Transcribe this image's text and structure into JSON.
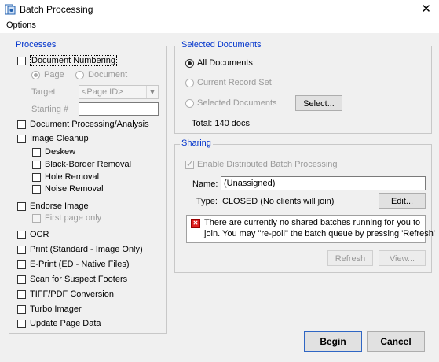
{
  "window": {
    "title": "Batch Processing",
    "close_glyph": "✕"
  },
  "menu": {
    "options": "Options"
  },
  "processes": {
    "legend": "Processes",
    "doc_numbering": "Document Numbering",
    "radio_page": "Page",
    "radio_document": "Document",
    "target_label": "Target",
    "target_value": "<Page ID>",
    "starting_label": "Starting #",
    "starting_value": "",
    "doc_processing": "Document Processing/Analysis",
    "image_cleanup": "Image Cleanup",
    "deskew": "Deskew",
    "black_border": "Black-Border Removal",
    "hole_removal": "Hole Removal",
    "noise_removal": "Noise Removal",
    "endorse_image": "Endorse Image",
    "first_page_only": "First page only",
    "ocr": "OCR",
    "print": "Print  (Standard - Image Only)",
    "eprint": "E-Print (ED - Native Files)",
    "scan_footers": "Scan for Suspect Footers",
    "tiff_pdf": "TIFF/PDF Conversion",
    "turbo_imager": "Turbo Imager",
    "update_page_data": "Update Page Data"
  },
  "selected_docs": {
    "legend": "Selected Documents",
    "all_documents": "All Documents",
    "current_record_set": "Current Record Set",
    "selected_documents": "Selected Documents",
    "select_button": "Select...",
    "total": "Total:  140 docs"
  },
  "sharing": {
    "legend": "Sharing",
    "enable_distributed": "Enable Distributed Batch Processing",
    "name_label": "Name:",
    "name_value": "(Unassigned)",
    "type_label": "Type:",
    "type_value": "CLOSED (No clients will join)",
    "edit_button": "Edit...",
    "info_line1": "There are currently no shared batches running for you to",
    "info_line2": "join.  You may \"re-poll\" the batch queue by pressing 'Refresh'",
    "refresh_button": "Refresh",
    "view_button": "View..."
  },
  "buttons": {
    "begin": "Begin",
    "cancel": "Cancel"
  }
}
